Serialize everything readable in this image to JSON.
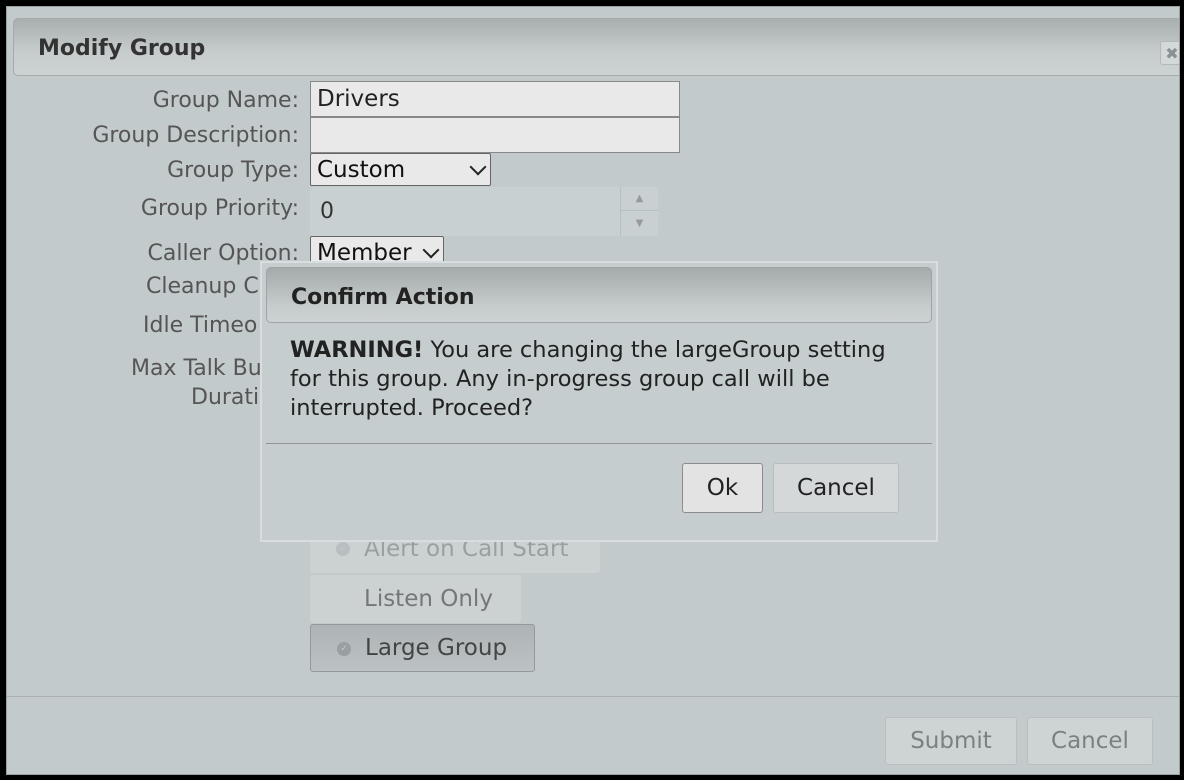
{
  "window": {
    "title": "Modify Group",
    "close_glyph": "✖"
  },
  "form": {
    "group_name_label": "Group Name:",
    "group_name_value": "Drivers",
    "group_description_label": "Group Description:",
    "group_description_value": "",
    "group_type_label": "Group Type:",
    "group_type_value": "Custom",
    "group_priority_label": "Group Priority:",
    "group_priority_value": "0",
    "caller_option_label": "Caller Option:",
    "caller_option_value": "Member",
    "cleanup_label_partial": "Cleanup C",
    "idle_timeout_label_partial": "Idle Timeo",
    "max_talk_label_partial_line1": "Max Talk Bu",
    "max_talk_label_partial_line2": "Durati",
    "toggles": {
      "alert_on_call_start": "Alert on Call Start",
      "listen_only": "Listen Only",
      "large_group": "Large Group"
    }
  },
  "footer": {
    "submit_label": "Submit",
    "cancel_label": "Cancel"
  },
  "confirm": {
    "title": "Confirm Action",
    "warning_bold": "WARNING!",
    "message": " You are changing the largeGroup setting for this group. Any in-progress group call will be interrupted. Proceed?",
    "ok_label": "Ok",
    "cancel_label": "Cancel"
  },
  "icons": {
    "close": "close-icon",
    "chevron": "chevron-down-icon",
    "spinner_up": "caret-up-icon",
    "spinner_down": "caret-down-icon",
    "check": "check-circle-icon"
  }
}
